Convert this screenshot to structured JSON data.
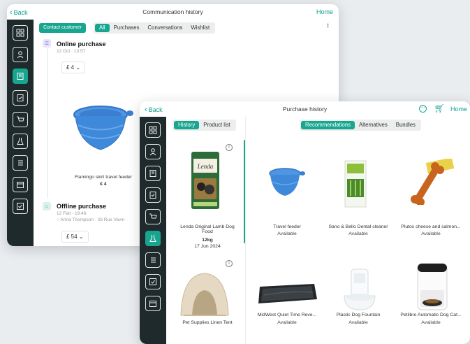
{
  "back_window": {
    "back_label": "Back",
    "title": "Communication history",
    "home_label": "Home",
    "contact_button": "Contact customer",
    "tabs": [
      "All",
      "Purchases",
      "Conversations",
      "Wishlist"
    ],
    "active_tab": "All",
    "online": {
      "title": "Online purchase",
      "date": "12 Oct · 13:57",
      "price": "£ 4",
      "product_name": "Flamingo skirt travel feeder",
      "product_price": "€ 4"
    },
    "offline": {
      "title": "Offline purchase",
      "date": "12 Feb · 19:48",
      "location": "Anna Thompson · 26 Rue Vavin",
      "price": "£ 54"
    }
  },
  "front_window": {
    "back_label": "Back",
    "title": "Purchase history",
    "home_label": "Home",
    "left_tabs": [
      "History",
      "Product list"
    ],
    "right_tabs": [
      "Recommendations",
      "Alternatives",
      "Bundles"
    ],
    "history_items": [
      {
        "name": "Lenda Original Lamb Dog Food",
        "size": "12kg",
        "date": "17 Jun 2024"
      },
      {
        "name": "Pet Supplies Linen Tent",
        "size": "",
        "date": ""
      }
    ],
    "recommendations": [
      {
        "name": "Travel feeder",
        "status": "Available"
      },
      {
        "name": "Sano & Bello Dental cleaner",
        "status": "Available"
      },
      {
        "name": "Plutos cheese and salmon...",
        "status": "Available"
      },
      {
        "name": "MidWest Quiet Time Reve...",
        "status": "Available"
      },
      {
        "name": "Plastic Dog Fountain",
        "status": "Available"
      },
      {
        "name": "Petlibro Automatic Dog Cat...",
        "status": "Available"
      }
    ],
    "brand_text": "Lenda"
  },
  "colors": {
    "accent": "#19a690",
    "sidebar": "#1f2a2d",
    "product_blue": "#3d86d6"
  },
  "sidebar_icons": [
    "grid-icon",
    "user-icon",
    "history-icon",
    "receipt-icon",
    "cart-icon",
    "flask-icon",
    "list-icon",
    "checkbox-icon",
    "calendar-icon"
  ]
}
